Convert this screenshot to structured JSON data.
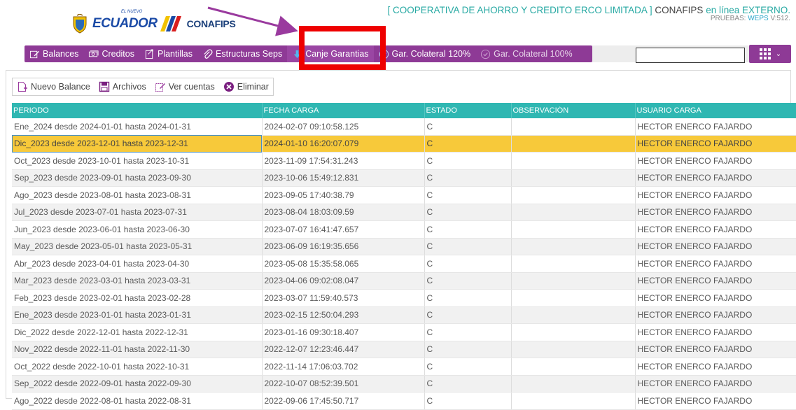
{
  "brand": {
    "logo_small_text": "EL NUEVO",
    "logo_text": "ECUADOR",
    "conafips_text": "CONAFIPS"
  },
  "header": {
    "coop_name": "[ COOPERATIVA DE AHORRO Y CREDITO ERCO LIMITADA ]",
    "org": "CONAFIPS",
    "status": "en línea EXTERNO.",
    "env_prefix": "PRUEBAS:",
    "env_link": "WEPS",
    "version": "V:512."
  },
  "toolbar": {
    "items": [
      {
        "label": "Balances",
        "icon": "edit-doc-icon"
      },
      {
        "label": "Creditos",
        "icon": "money-icon"
      },
      {
        "label": "Plantillas",
        "icon": "template-icon"
      },
      {
        "label": "Estructuras Seps",
        "icon": "paperclip-icon"
      },
      {
        "label": "Canje Garantias",
        "icon": "download-arrow-icon"
      },
      {
        "label": "Gar. Colateral 120%",
        "icon": "check-circle-icon"
      },
      {
        "label": "Gar. Colateral 100%",
        "icon": "check-circle-icon"
      }
    ],
    "search_value": ""
  },
  "actions": {
    "new_balance": "Nuevo Balance",
    "archives": "Archivos",
    "view_accounts": "Ver cuentas",
    "delete": "Eliminar"
  },
  "table": {
    "columns": [
      "PERIODO",
      "FECHA CARGA",
      "ESTADO",
      "OBSERVACIÓN",
      "USUARIO CARGA"
    ],
    "rows": [
      [
        "Ene_2024 desde 2024-01-01 hasta 2024-01-31",
        "2024-02-07 09:10:58.125",
        "C",
        "",
        "HECTOR ENERCO FAJARDO"
      ],
      [
        "Dic_2023 desde 2023-12-01 hasta 2023-12-31",
        "2024-01-10 16:20:07.079",
        "C",
        "",
        "HECTOR ENERCO FAJARDO"
      ],
      [
        "Oct_2023 desde 2023-10-01 hasta 2023-10-31",
        "2023-11-09 17:54:31.243",
        "C",
        "",
        "HECTOR ENERCO FAJARDO"
      ],
      [
        "Sep_2023 desde 2023-09-01 hasta 2023-09-30",
        "2023-10-06 15:49:12.831",
        "C",
        "",
        "HECTOR ENERCO FAJARDO"
      ],
      [
        "Ago_2023 desde 2023-08-01 hasta 2023-08-31",
        "2023-09-05 17:40:38.79",
        "C",
        "",
        "HECTOR ENERCO FAJARDO"
      ],
      [
        "Jul_2023 desde 2023-07-01 hasta 2023-07-31",
        "2023-08-04 18:03:09.59",
        "C",
        "",
        "HECTOR ENERCO FAJARDO"
      ],
      [
        "Jun_2023 desde 2023-06-01 hasta 2023-06-30",
        "2023-07-07 16:41:47.657",
        "C",
        "",
        "HECTOR ENERCO FAJARDO"
      ],
      [
        "May_2023 desde 2023-05-01 hasta 2023-05-31",
        "2023-06-09 16:19:35.656",
        "C",
        "",
        "HECTOR ENERCO FAJARDO"
      ],
      [
        "Abr_2023 desde 2023-04-01 hasta 2023-04-30",
        "2023-05-08 15:35:58.065",
        "C",
        "",
        "HECTOR ENERCO FAJARDO"
      ],
      [
        "Mar_2023 desde 2023-03-01 hasta 2023-03-31",
        "2023-04-06 09:02:08.047",
        "C",
        "",
        "HECTOR ENERCO FAJARDO"
      ],
      [
        "Feb_2023 desde 2023-02-01 hasta 2023-02-28",
        "2023-03-07 11:59:40.573",
        "C",
        "",
        "HECTOR ENERCO FAJARDO"
      ],
      [
        "Ene_2023 desde 2023-01-01 hasta 2023-01-31",
        "2023-02-15 12:50:04.293",
        "C",
        "",
        "HECTOR ENERCO FAJARDO"
      ],
      [
        "Dic_2022 desde 2022-12-01 hasta 2022-12-31",
        "2023-01-16 09:30:18.407",
        "C",
        "",
        "HECTOR ENERCO FAJARDO"
      ],
      [
        "Nov_2022 desde 2022-11-01 hasta 2022-11-30",
        "2022-12-07 12:23:46.447",
        "C",
        "",
        "HECTOR ENERCO FAJARDO"
      ],
      [
        "Oct_2022 desde 2022-10-01 hasta 2022-10-31",
        "2022-11-14 17:06:03.702",
        "C",
        "",
        "HECTOR ENERCO FAJARDO"
      ],
      [
        "Sep_2022 desde 2022-09-01 hasta 2022-09-30",
        "2022-10-07 08:52:39.501",
        "C",
        "",
        "HECTOR ENERCO FAJARDO"
      ],
      [
        "Ago_2022 desde 2022-08-01 hasta 2022-08-31",
        "2022-09-06 17:45:50.717",
        "C",
        "",
        "HECTOR ENERCO FAJARDO"
      ]
    ],
    "selected_row": 1
  },
  "colors": {
    "toolbar": "#8e3a96",
    "header_teal": "#2fb7b2",
    "selected_row": "#f7c93a",
    "highlight_red": "#ee0000",
    "arrow": "#9a3a9e"
  }
}
